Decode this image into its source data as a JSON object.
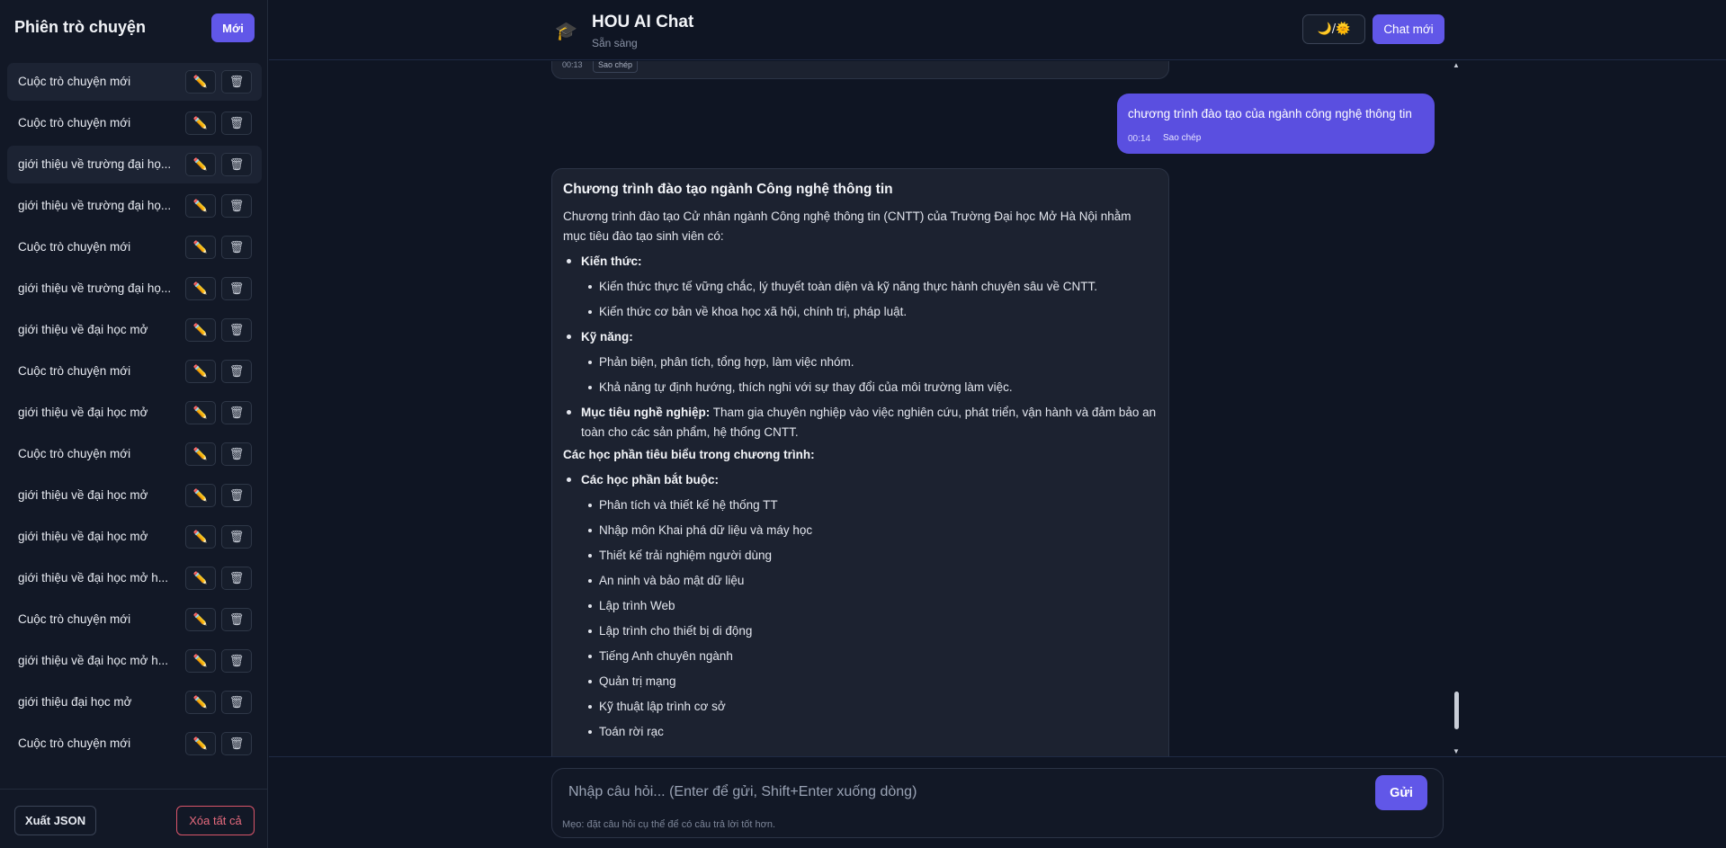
{
  "sidebar": {
    "title": "Phiên trò chuyện",
    "new_label": "Mới",
    "edit_icon": "✏️",
    "delete_icon": "🗑",
    "items": [
      {
        "label": "Cuộc trò chuyện mới"
      },
      {
        "label": "Cuộc trò chuyện mới"
      },
      {
        "label": "giới thiệu về trường đại họ..."
      },
      {
        "label": "giới thiệu về trường đại họ..."
      },
      {
        "label": "Cuộc trò chuyện mới"
      },
      {
        "label": "giới thiệu về trường đại họ..."
      },
      {
        "label": "giới thiệu về đại học mở"
      },
      {
        "label": "Cuộc trò chuyện mới"
      },
      {
        "label": "giới thiệu về đại học mở"
      },
      {
        "label": "Cuộc trò chuyện mới"
      },
      {
        "label": "giới thiệu về đại học mở"
      },
      {
        "label": "giới thiệu về đại học mở"
      },
      {
        "label": "giới thiệu về đại học mở h..."
      },
      {
        "label": "Cuộc trò chuyện mới"
      },
      {
        "label": "giới thiệu về đại học mở h..."
      },
      {
        "label": "giới thiệu đại học mở"
      },
      {
        "label": "Cuộc trò chuyện mới"
      }
    ],
    "export_label": "Xuất JSON",
    "clear_label": "Xóa tất cả"
  },
  "header": {
    "logo": "🎓",
    "title": "HOU AI Chat",
    "status": "Sẵn sàng",
    "theme_label": "🌙/🌞",
    "new_chat_label": "Chat mới"
  },
  "chat": {
    "previous": {
      "time": "00:13",
      "copy_label": "Sao chép"
    },
    "user_message": {
      "text": "chương trình đào tạo của ngành công nghệ thông tin",
      "time": "00:14",
      "copy_label": "Sao chép"
    },
    "bot_message": {
      "heading": "Chương trình đào tạo ngành Công nghệ thông tin",
      "intro": "Chương trình đào tạo Cử nhân ngành Công nghệ thông tin (CNTT) của Trường Đại học Mở Hà Nội nhằm mục tiêu đào tạo sinh viên có:",
      "knowledge_title": "Kiến thức:",
      "knowledge": [
        "Kiến thức thực tế vững chắc, lý thuyết toàn diện và kỹ năng thực hành chuyên sâu về CNTT.",
        "Kiến thức cơ bản về khoa học xã hội, chính trị, pháp luật."
      ],
      "skills_title": "Kỹ năng:",
      "skills": [
        "Phản biện, phân tích, tổng hợp, làm việc nhóm.",
        "Khả năng tự định hướng, thích nghi với sự thay đổi của môi trường làm việc."
      ],
      "career_title": "Mục tiêu nghề nghiệp:",
      "career_text": "Tham gia chuyên nghiệp vào việc nghiên cứu, phát triển, vận hành và đảm bảo an toàn cho các sản phẩm, hệ thống CNTT.",
      "courses_heading": "Các học phần tiêu biểu trong chương trình:",
      "required_title": "Các học phần bắt buộc:",
      "required": [
        "Phân tích và thiết kế hệ thống TT",
        "Nhập môn Khai phá dữ liệu và máy học",
        "Thiết kế trải nghiệm người dùng",
        "An ninh và bảo mật dữ liệu",
        "Lập trình Web",
        "Lập trình cho thiết bị di động",
        "Tiếng Anh chuyên ngành",
        "Quản trị mạng",
        "Kỹ thuật lập trình cơ sở",
        "Toán rời rạc"
      ]
    }
  },
  "composer": {
    "placeholder": "Nhập câu hỏi... (Enter để gửi, Shift+Enter xuống dòng)",
    "send_label": "Gửi",
    "hint": "Mẹo: đặt câu hỏi cụ thể để có câu trả lời tốt hơn."
  },
  "colors": {
    "accent": "#6157e8",
    "user_bubble": "#5a4fe0",
    "background": "#0f1523",
    "danger": "#e56a7d"
  }
}
